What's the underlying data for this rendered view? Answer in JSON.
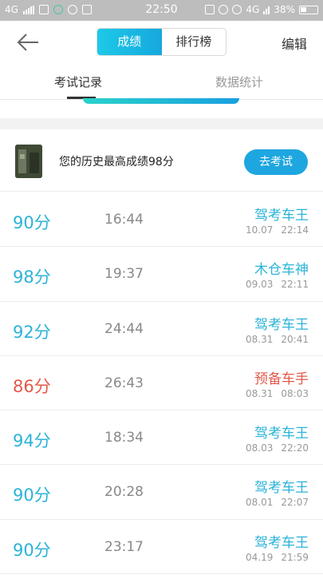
{
  "status_bar": {
    "network": "4G",
    "time": "22:50",
    "network_right": "4G",
    "battery": "38%"
  },
  "header": {
    "segments": [
      "成绩",
      "排行榜"
    ],
    "active_segment": "成绩",
    "edit_label": "编辑"
  },
  "tabs": [
    "考试记录",
    "数据统计"
  ],
  "best": {
    "text": "您的历史最高成绩98分",
    "button": "去考试"
  },
  "colors": {
    "accent": "#1ea6e0",
    "score_blue": "#2bb3d8",
    "score_red": "#e25a4a"
  },
  "records": [
    {
      "score": "90分",
      "duration": "16:44",
      "title": "驾考车王",
      "date": "10.07",
      "time": "22:14",
      "color": "blue"
    },
    {
      "score": "98分",
      "duration": "19:37",
      "title": "木仓车神",
      "date": "09.03",
      "time": "22:11",
      "color": "blue"
    },
    {
      "score": "92分",
      "duration": "24:44",
      "title": "驾考车王",
      "date": "08.31",
      "time": "20:41",
      "color": "blue"
    },
    {
      "score": "86分",
      "duration": "26:43",
      "title": "预备车手",
      "date": "08.31",
      "time": "08:03",
      "color": "red"
    },
    {
      "score": "94分",
      "duration": "18:34",
      "title": "驾考车王",
      "date": "08.03",
      "time": "22:20",
      "color": "blue"
    },
    {
      "score": "90分",
      "duration": "20:28",
      "title": "驾考车王",
      "date": "08.01",
      "time": "22:07",
      "color": "blue"
    },
    {
      "score": "90分",
      "duration": "23:17",
      "title": "驾考车王",
      "date": "04.19",
      "time": "21:59",
      "color": "blue"
    }
  ]
}
